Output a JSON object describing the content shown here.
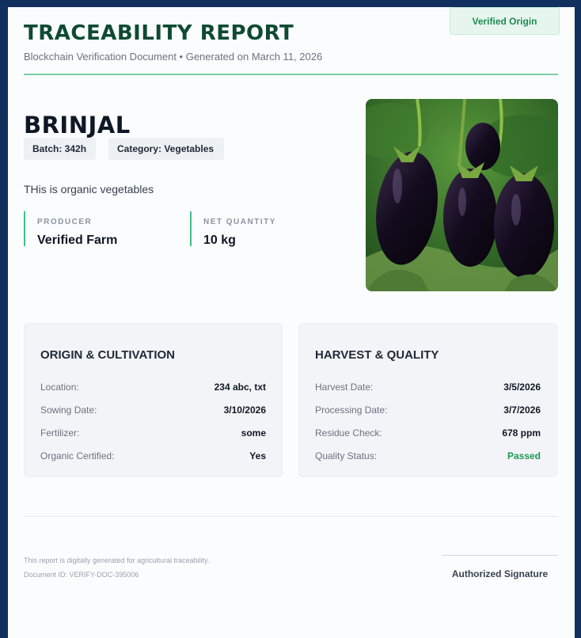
{
  "header": {
    "title": "TRACEABILITY REPORT",
    "subtitle": "Blockchain Verification Document • Generated on March 11, 2026",
    "badge": "Verified Origin"
  },
  "product": {
    "name": "BRINJAL",
    "batch": "Batch: 342h",
    "category": "Category: Vegetables",
    "description": "THis is organic vegetables",
    "producer_label": "PRODUCER",
    "producer": "Verified Farm",
    "quantity_label": "NET QUANTITY",
    "quantity": "10 kg"
  },
  "origin": {
    "title": "ORIGIN & CULTIVATION",
    "rows": [
      {
        "label": "Location:",
        "value": "234 abc, txt"
      },
      {
        "label": "Sowing Date:",
        "value": "3/10/2026"
      },
      {
        "label": "Fertilizer:",
        "value": "some"
      },
      {
        "label": "Organic Certified:",
        "value": "Yes"
      }
    ]
  },
  "harvest": {
    "title": "HARVEST & QUALITY",
    "rows": [
      {
        "label": "Harvest Date:",
        "value": "3/5/2026"
      },
      {
        "label": "Processing Date:",
        "value": "3/7/2026"
      },
      {
        "label": "Residue Check:",
        "value": "678 ppm"
      },
      {
        "label": "Quality Status:",
        "value": "Passed"
      }
    ]
  },
  "footer": {
    "note": "This report is digitally generated for agricultural traceability.",
    "doc_id": "Document ID: VERIFY-DOC-395006",
    "signature": "Authorized Signature"
  },
  "colors": {
    "brand": "#0f4a33",
    "accent": "#3fbf88",
    "passed": "#1f9a55"
  }
}
